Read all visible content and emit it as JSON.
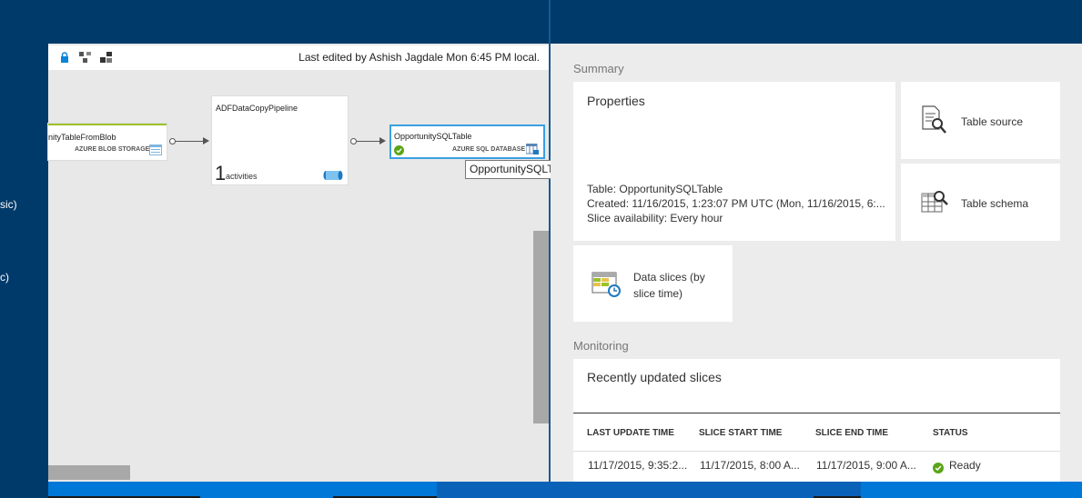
{
  "left_nav": {
    "items": [
      "sic)",
      "c)"
    ]
  },
  "toolbar": {
    "last_edited": "Last edited by Ashish Jagdale Mon 6:45 PM local."
  },
  "diagram": {
    "source_node": {
      "title": "nityTableFromBlob",
      "subtitle": "AZURE BLOB STORAGE"
    },
    "pipeline_node": {
      "title": "ADFDataCopyPipeline",
      "count": "1",
      "count_label": "activities"
    },
    "target_node": {
      "title": "OpportunitySQLTable",
      "subtitle": "AZURE SQL DATABASE"
    },
    "tooltip": "OpportunitySQLTable"
  },
  "summary": {
    "label": "Summary",
    "properties": {
      "title": "Properties",
      "lines": [
        "Table: OpportunitySQLTable",
        "Created: 11/16/2015, 1:23:07 PM UTC (Mon, 11/16/2015, 6:...",
        "Slice availability: Every hour"
      ]
    },
    "table_source": "Table source",
    "table_schema": "Table schema",
    "data_slices": "Data slices (by slice time)"
  },
  "monitoring": {
    "label": "Monitoring",
    "title": "Recently updated slices",
    "columns": [
      "LAST UPDATE TIME",
      "SLICE START TIME",
      "SLICE END TIME",
      "STATUS"
    ],
    "rows": [
      [
        "11/17/2015, 9:35:2...",
        "11/17/2015, 8:00 A...",
        "11/17/2015, 9:00 A...",
        "Ready"
      ]
    ]
  },
  "colors": {
    "accent": "#0078d7",
    "selected_border": "#3aa0e0",
    "ready_green": "#5ba518",
    "source_green": "#9cc12a"
  }
}
